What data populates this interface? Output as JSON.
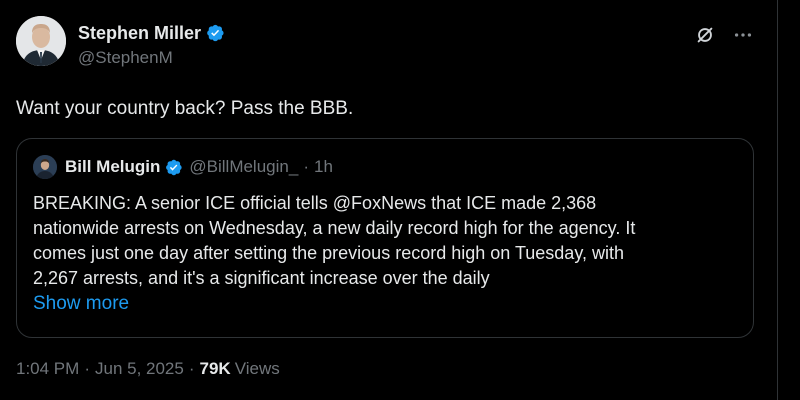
{
  "author": {
    "display_name": "Stephen Miller",
    "handle": "@StephenM",
    "verified": true
  },
  "tweet": {
    "text": "Want your country back? Pass the BBB."
  },
  "quoted_tweet": {
    "author": {
      "display_name": "Bill Melugin",
      "handle": "@BillMelugin_",
      "verified": true
    },
    "separator": "·",
    "time": "1h",
    "body_lines": [
      "BREAKING: A senior ICE official tells @FoxNews that ICE made 2,368",
      "nationwide arrests on Wednesday, a new daily record high for the agency. It",
      "comes just one day after setting the previous record high on Tuesday, with",
      "2,267 arrests, and it's a significant increase over the daily"
    ],
    "show_more_label": "Show more"
  },
  "meta": {
    "time": "1:04 PM",
    "date": "Jun 5, 2025",
    "separator": "·",
    "views_count": "79K",
    "views_label": "Views"
  },
  "colors": {
    "background": "#000000",
    "text": "#e7e9ea",
    "muted": "#71767b",
    "accent": "#1d9bf0",
    "border": "#2f3336"
  },
  "icons": [
    "verified-badge-icon",
    "grok-icon",
    "more-options-icon"
  ]
}
